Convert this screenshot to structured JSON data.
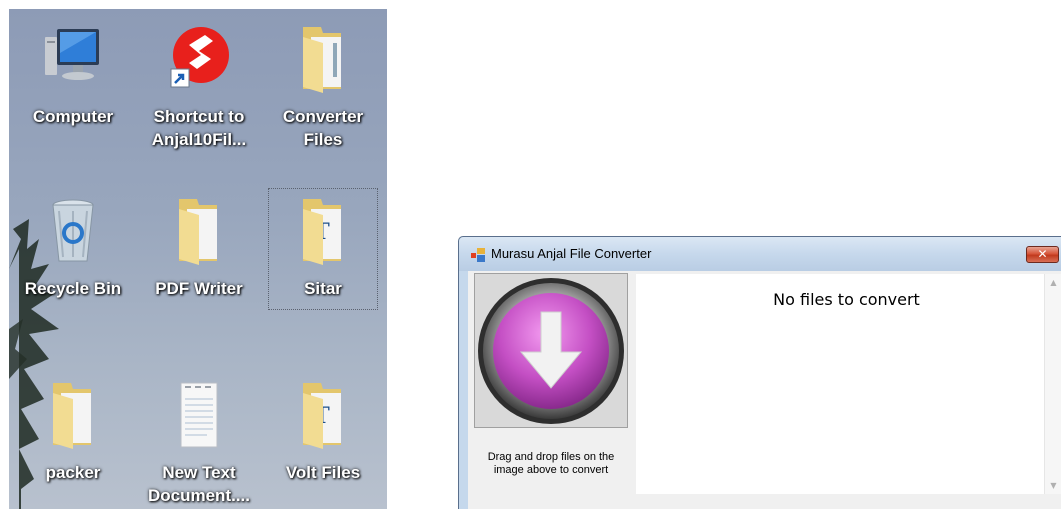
{
  "desktop": {
    "icons": [
      {
        "label_line1": "Computer",
        "label_line2": "",
        "icon": "computer-icon"
      },
      {
        "label_line1": "Shortcut to",
        "label_line2": "Anjal10Fil...",
        "icon": "anjal-shortcut-icon"
      },
      {
        "label_line1": "Converter",
        "label_line2": "Files",
        "icon": "folder-icon"
      },
      {
        "label_line1": "Recycle Bin",
        "label_line2": "",
        "icon": "recycle-bin-icon"
      },
      {
        "label_line1": "PDF Writer",
        "label_line2": "",
        "icon": "folder-icon"
      },
      {
        "label_line1": "Sitar",
        "label_line2": "",
        "icon": "folder-icon"
      },
      {
        "label_line1": "packer",
        "label_line2": "",
        "icon": "folder-icon"
      },
      {
        "label_line1": "New Text",
        "label_line2": "Document....",
        "icon": "text-document-icon"
      },
      {
        "label_line1": "Volt Files",
        "label_line2": "",
        "icon": "folder-icon"
      }
    ]
  },
  "window": {
    "title": "Murasu Anjal File Converter",
    "close_label": "✕",
    "drop_hint": "Drag and drop files on the image above to convert",
    "status": "No files to convert",
    "accent_color": "#c44fc4"
  }
}
